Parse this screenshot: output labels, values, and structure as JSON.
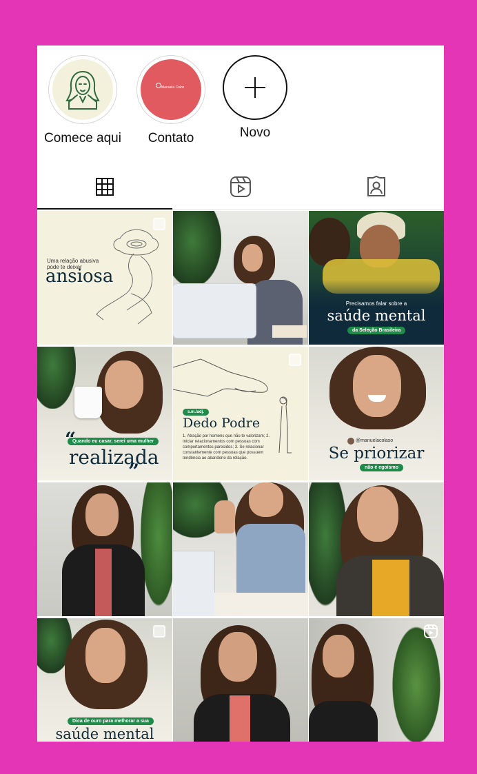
{
  "highlights": [
    {
      "label": "Comece aqui",
      "icon": "woman-line-drawing-icon",
      "bg": "#f3f1dc"
    },
    {
      "label": "Contato",
      "icon": "contact-card-image",
      "bg": "#e05a5f",
      "inner_text": "Manuela Coloz"
    },
    {
      "label": "Novo",
      "icon": "plus-icon"
    }
  ],
  "tabs": [
    {
      "name": "grid",
      "icon": "grid-icon",
      "active": true
    },
    {
      "name": "reels",
      "icon": "reels-icon",
      "active": false
    },
    {
      "name": "tagged",
      "icon": "tagged-person-icon",
      "active": false
    }
  ],
  "posts": {
    "p1": {
      "small": "Uma relação abusiva pode te deixar",
      "big": "ansiosa"
    },
    "p3": {
      "sub": "Precisamos falar sobre a",
      "big": "saúde mental",
      "pill": "da Seleção Brasileira"
    },
    "p4": {
      "pill": "Quando eu casar, serei uma mulher",
      "big": "realizada"
    },
    "p5": {
      "badge": "s.m./adj.",
      "big": "Dedo Podre",
      "body": "1. Atração por homens que não te valorizam; 2. Iniciar relacionamentos com pessoas com comportamentos parecidos; 3. Se relacionar constantemente com pessoas que possuem tendência ao abandono da relação."
    },
    "p6": {
      "handle": "@manuelacolaso",
      "big": "Se priorizar",
      "pill": "não é egoísmo"
    },
    "p10": {
      "pill": "Dica de ouro para melhorar a sua",
      "big": "saúde mental"
    }
  },
  "colors": {
    "frame": "#e335b5",
    "accent_green": "#1f8a4a",
    "navy": "#0f2a3a"
  }
}
